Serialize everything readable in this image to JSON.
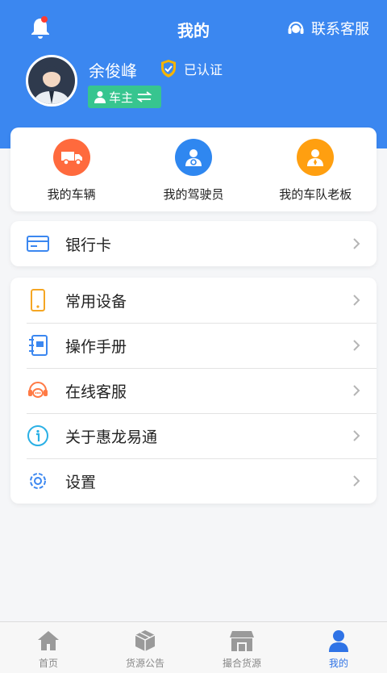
{
  "header": {
    "title": "我的",
    "service_label": "联系客服",
    "username": "余俊峰",
    "verified_label": "已认证",
    "role_label": "车主"
  },
  "quick_actions": [
    {
      "label": "我的车辆",
      "color": "#ff6a3d",
      "icon": "truck-icon"
    },
    {
      "label": "我的驾驶员",
      "color": "#2f87f0",
      "icon": "driver-icon"
    },
    {
      "label": "我的车队老板",
      "color": "#ff9f10",
      "icon": "boss-icon"
    }
  ],
  "bank": {
    "label": "银行卡",
    "icon": "bank-card-icon"
  },
  "menu": [
    {
      "label": "常用设备",
      "icon": "phone-device-icon"
    },
    {
      "label": "操作手册",
      "icon": "manual-icon"
    },
    {
      "label": "在线客服",
      "icon": "online-service-icon"
    },
    {
      "label": "关于惠龙易通",
      "icon": "info-icon"
    },
    {
      "label": "设置",
      "icon": "gear-icon"
    }
  ],
  "tabs": [
    {
      "label": "首页",
      "icon": "home-icon"
    },
    {
      "label": "货源公告",
      "icon": "package-icon"
    },
    {
      "label": "撮合货源",
      "icon": "store-icon"
    },
    {
      "label": "我的",
      "icon": "user-icon",
      "active": true
    }
  ],
  "colors": {
    "header_bg": "#3b87f0",
    "accent": "#2f73e6",
    "role_badge": "#37c58f",
    "notification_dot": "#ff3b30"
  }
}
